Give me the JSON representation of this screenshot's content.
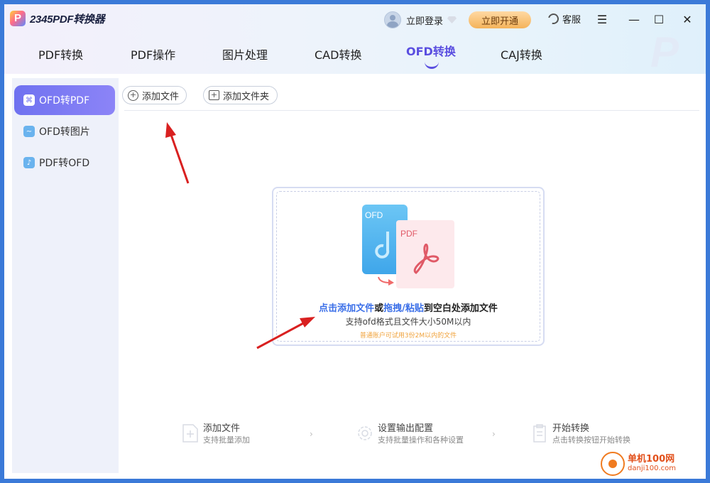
{
  "header": {
    "app_title": "2345PDF转换器",
    "logo_letter": "P",
    "login_label": "立即登录",
    "vip_button": "立即开通",
    "service_label": "客服",
    "menu_glyph": "☰",
    "minimize_glyph": "—",
    "maximize_glyph": "☐",
    "close_glyph": "✕"
  },
  "tabs": [
    {
      "label": "PDF转换"
    },
    {
      "label": "PDF操作"
    },
    {
      "label": "图片处理"
    },
    {
      "label": "CAD转换"
    },
    {
      "label": "OFD转换"
    },
    {
      "label": "CAJ转换"
    }
  ],
  "sidebar": {
    "items": [
      {
        "label": "OFD转PDF",
        "icon": "pdf-doc-icon"
      },
      {
        "label": "OFD转图片",
        "icon": "image-icon"
      },
      {
        "label": "PDF转OFD",
        "icon": "ofd-icon"
      }
    ]
  },
  "toolbar": {
    "add_file": "添加文件",
    "add_folder": "添加文件夹"
  },
  "dropzone": {
    "ofd_tag": "OFD",
    "pdf_tag": "PDF",
    "main_link1": "点击添加文件",
    "main_or": "或",
    "main_link2": "拖拽/粘贴",
    "main_rest": "到空白处添加文件",
    "sub": "支持ofd格式且文件大小50M以内",
    "tip": "普通账户可试用3份2M以内的文件"
  },
  "steps": [
    {
      "title": "添加文件",
      "desc": "支持批量添加"
    },
    {
      "title": "设置输出配置",
      "desc": "支持批量操作和各种设置"
    },
    {
      "title": "开始转换",
      "desc": "点击转换按钮开始转换"
    }
  ],
  "watermark": {
    "name": "单机100网",
    "url": "danji100.com"
  },
  "colors": {
    "accent": "#5a4ee0",
    "link": "#3b6fe8",
    "tip": "#f0a23a",
    "annotation_arrow": "#d92020"
  }
}
